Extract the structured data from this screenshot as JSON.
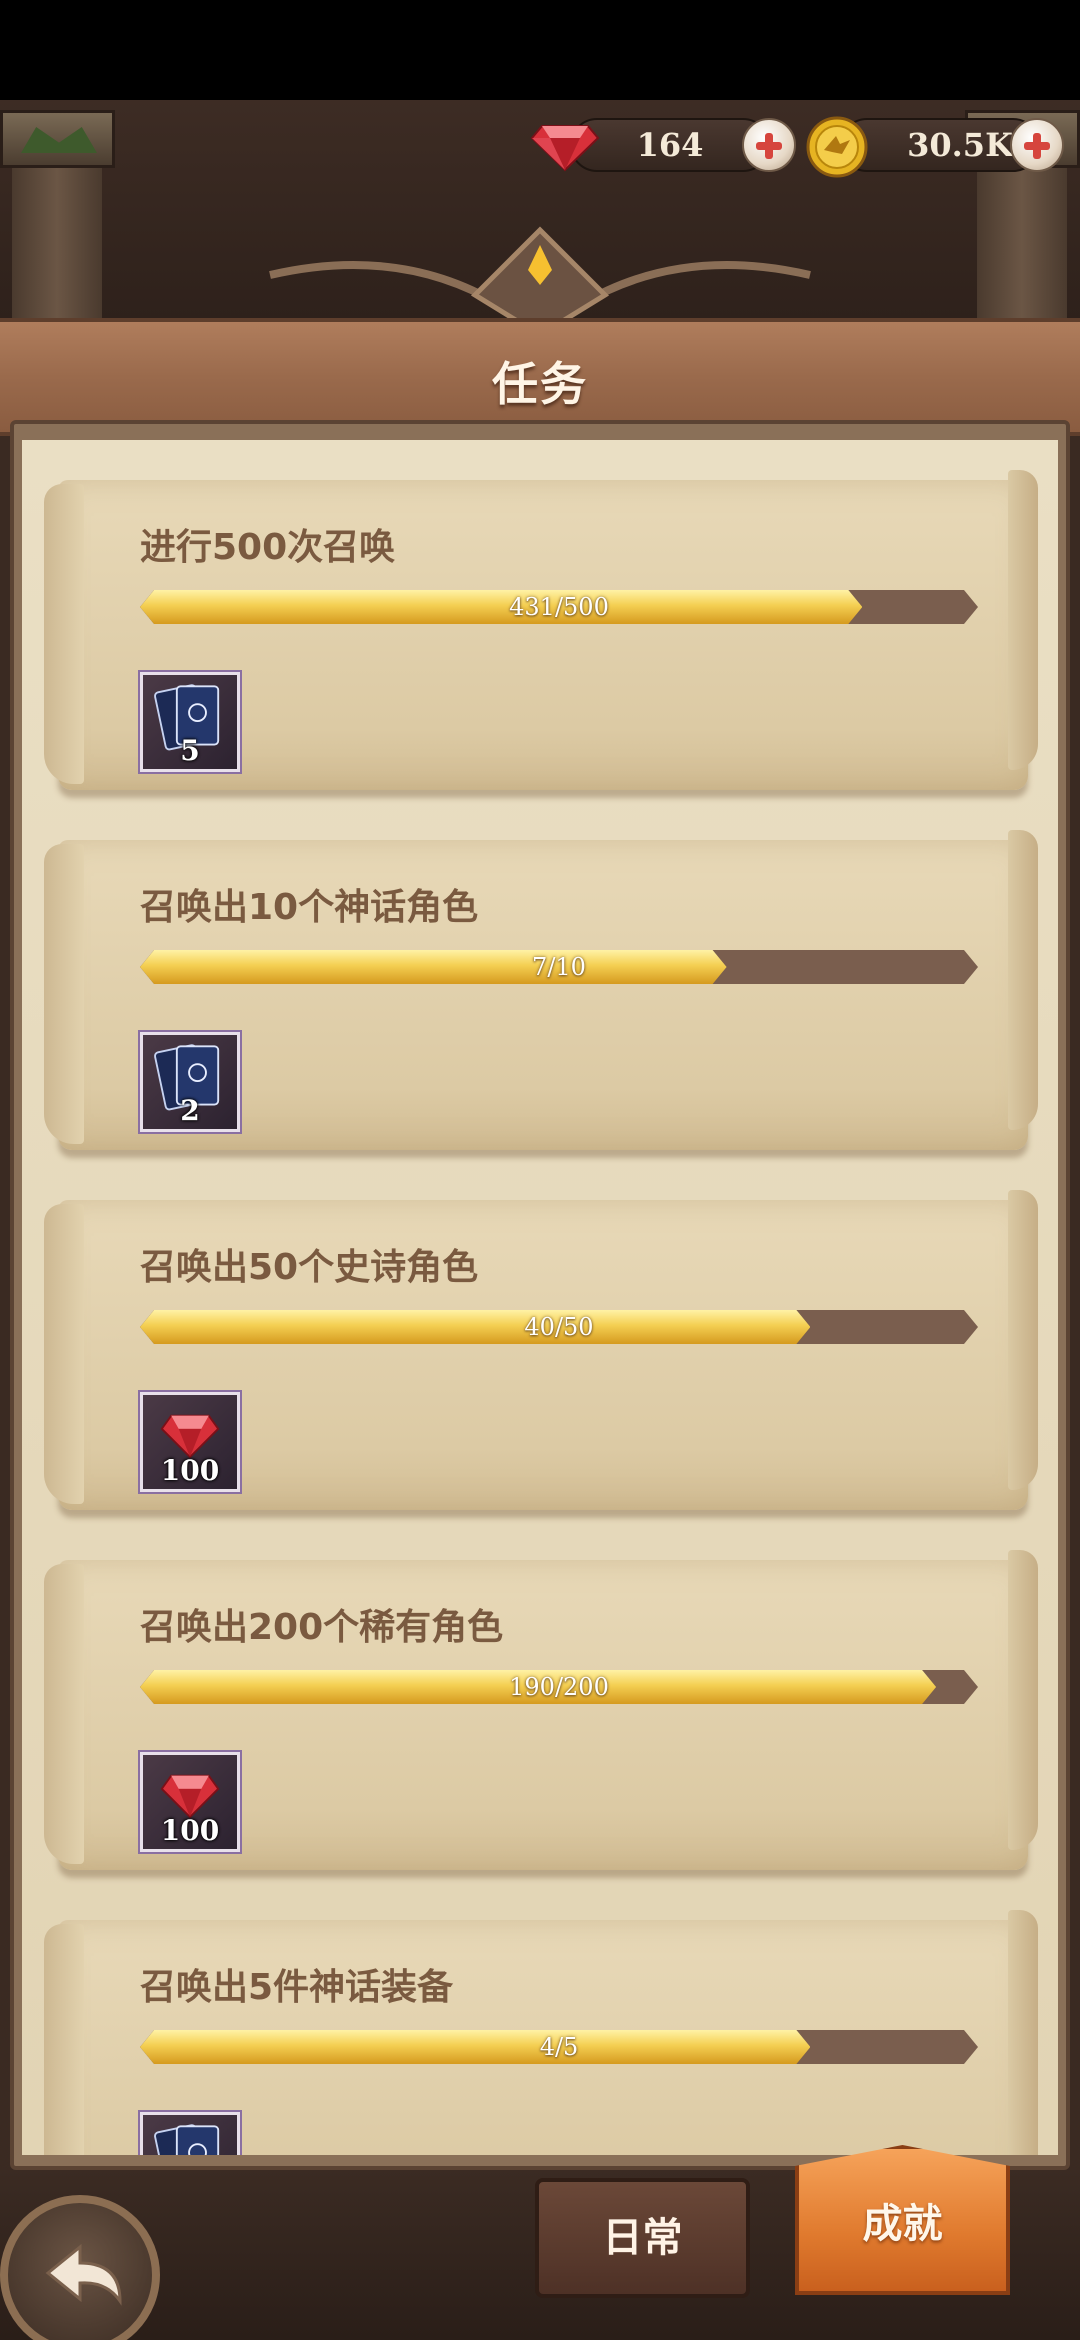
{
  "currencies": {
    "gems": "164",
    "gold": "30.5K"
  },
  "title": "任务",
  "quests": [
    {
      "title": "进行500次召唤",
      "progress_text": "431/500",
      "progress": 0.862,
      "reward_icon": "card-deck-icon",
      "reward_count": "5"
    },
    {
      "title": "召唤出10个神话角色",
      "progress_text": "7/10",
      "progress": 0.7,
      "reward_icon": "card-deck-icon",
      "reward_count": "2"
    },
    {
      "title": "召唤出50个史诗角色",
      "progress_text": "40/50",
      "progress": 0.8,
      "reward_icon": "ruby-gem-icon",
      "reward_count": "100"
    },
    {
      "title": "召唤出200个稀有角色",
      "progress_text": "190/200",
      "progress": 0.95,
      "reward_icon": "ruby-gem-icon",
      "reward_count": "100"
    },
    {
      "title": "召唤出5件神话装备",
      "progress_text": "4/5",
      "progress": 0.8,
      "reward_icon": "card-deck-icon",
      "reward_count": ""
    }
  ],
  "tabs": {
    "daily": "日常",
    "achievements": "成就"
  }
}
